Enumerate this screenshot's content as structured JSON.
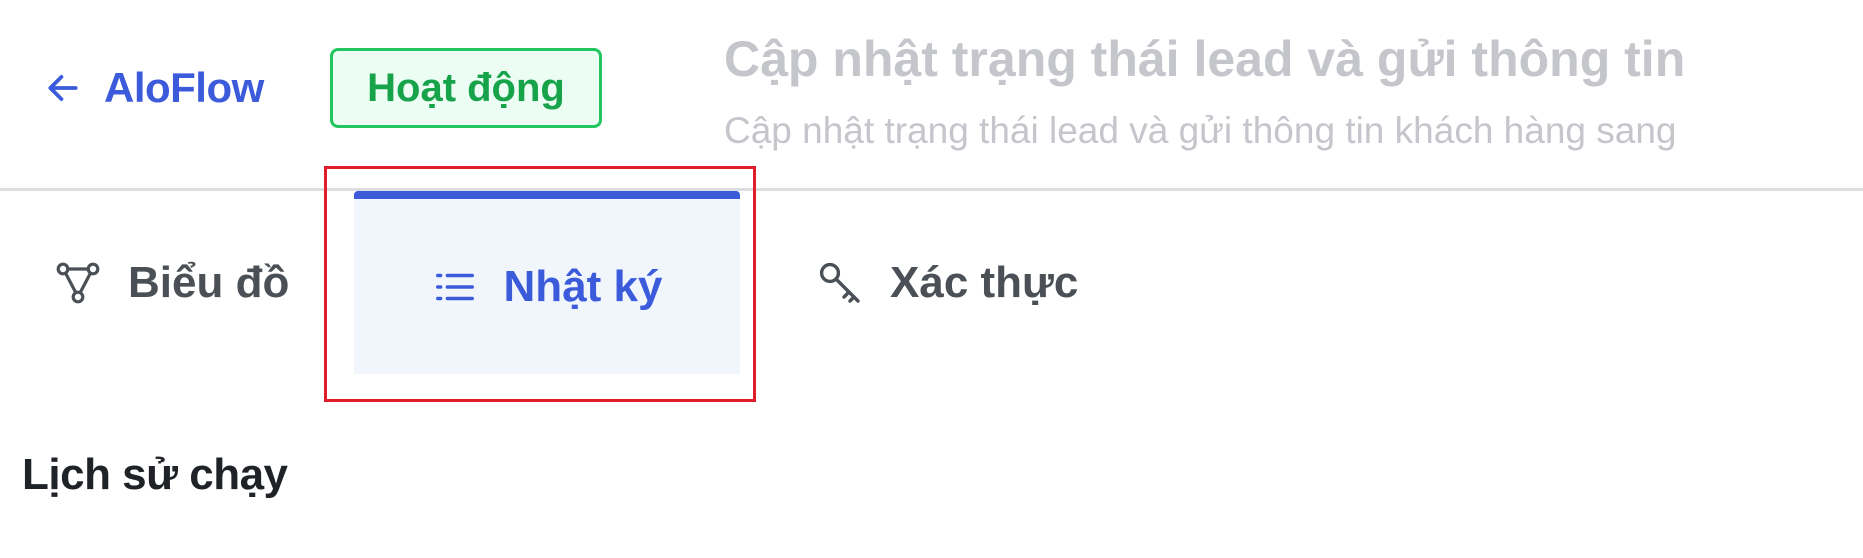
{
  "header": {
    "back_label": "AloFlow",
    "status_badge": "Hoạt động",
    "flow_title": "Cập nhật trạng thái lead và gửi thông tin khách hàng sang CRM",
    "flow_description": "Cập nhật trạng thái lead và gửi thông tin khách hàng sang CRM"
  },
  "tabs": [
    {
      "label": "Biểu đồ",
      "icon": "diagram-icon",
      "active": false
    },
    {
      "label": "Nhật ký",
      "icon": "list-icon",
      "active": true
    },
    {
      "label": "Xác thực",
      "icon": "key-icon",
      "active": false
    }
  ],
  "section": {
    "title": "Lịch sử chạy"
  },
  "colors": {
    "accent": "#3b5bdb",
    "status_green": "#16a34a",
    "status_green_bg": "#ecfdf3",
    "active_tab_bg": "#f1f6fd",
    "highlight_red": "#e11d2a",
    "muted_text": "#c4c6cb"
  }
}
